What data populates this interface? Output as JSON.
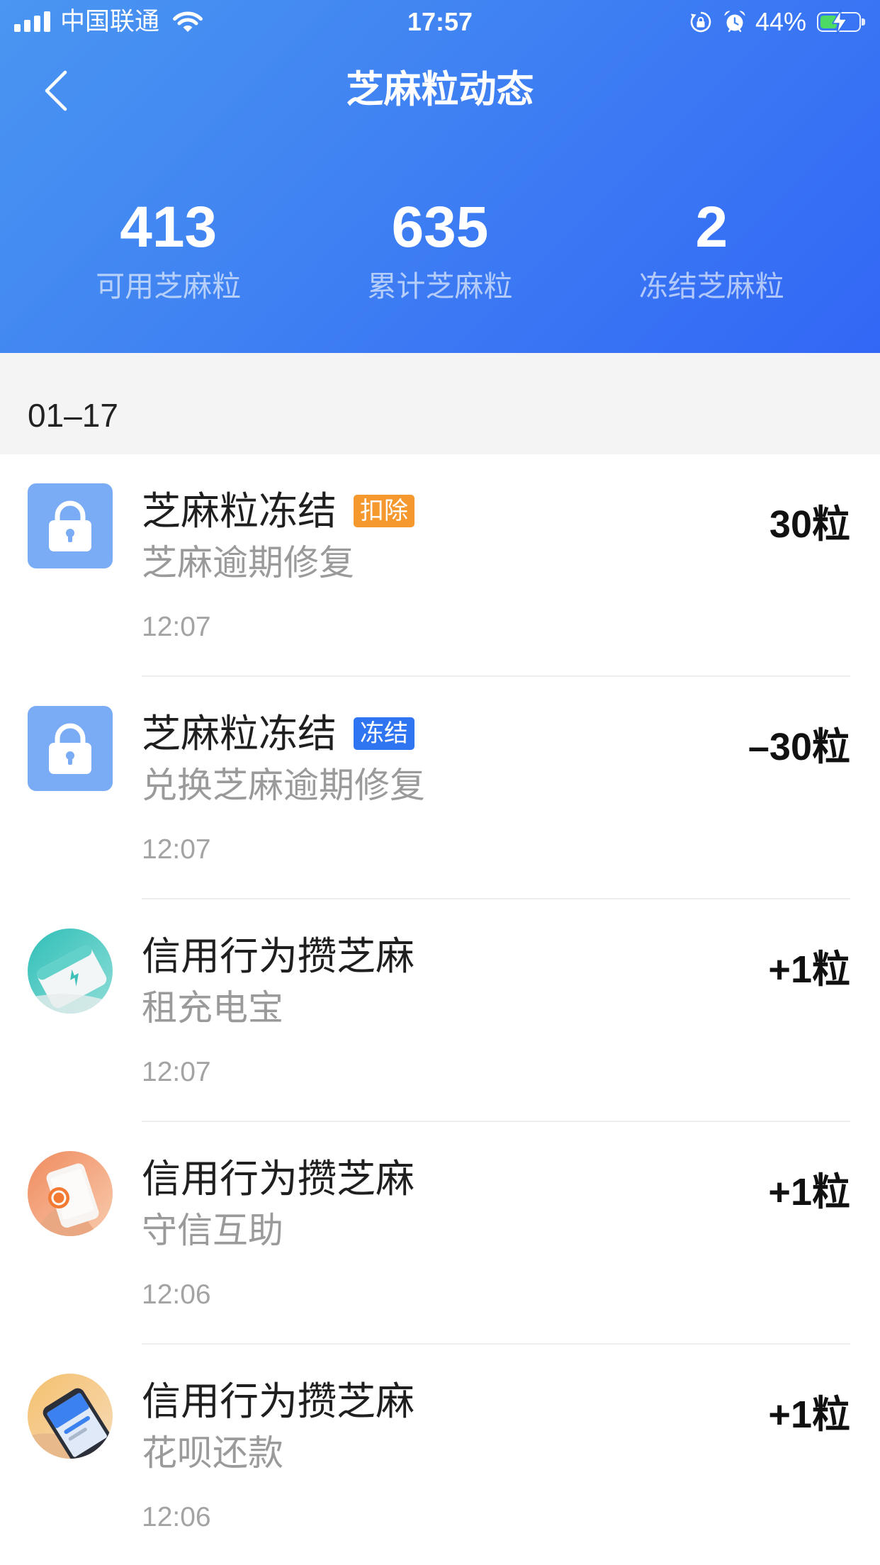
{
  "status_bar": {
    "carrier": "中国联通",
    "time": "17:57",
    "battery_percent": "44%",
    "battery_level": 0.44,
    "charging": true,
    "icons": {
      "signal": "signal-icon",
      "wifi": "wifi-icon",
      "rotation_lock": "rotation-lock-icon",
      "alarm": "alarm-icon",
      "battery": "battery-charging-icon"
    }
  },
  "nav": {
    "back_icon": "chevron-left-icon",
    "title": "芝麻粒动态"
  },
  "stats": [
    {
      "value": "413",
      "label": "可用芝麻粒"
    },
    {
      "value": "635",
      "label": "累计芝麻粒"
    },
    {
      "value": "2",
      "label": "冻结芝麻粒"
    }
  ],
  "date_header": "01–17",
  "records": [
    {
      "icon": "lock-icon",
      "title": "芝麻粒冻结",
      "tag": "扣除",
      "tag_color": "#f5992f",
      "subtitle": "芝麻逾期修复",
      "time": "12:07",
      "amount": "30粒"
    },
    {
      "icon": "lock-icon",
      "title": "芝麻粒冻结",
      "tag": "冻结",
      "tag_color": "#2f74f1",
      "subtitle": "兑换芝麻逾期修复",
      "time": "12:07",
      "amount": "–30粒"
    },
    {
      "icon": "power-bank-icon",
      "title": "信用行为攒芝麻",
      "subtitle": "租充电宝",
      "time": "12:07",
      "amount": "+1粒"
    },
    {
      "icon": "mutual-aid-icon",
      "title": "信用行为攒芝麻",
      "subtitle": "守信互助",
      "time": "12:06",
      "amount": "+1粒"
    },
    {
      "icon": "huabei-repay-icon",
      "title": "信用行为攒芝麻",
      "subtitle": "花呗还款",
      "time": "12:06",
      "amount": "+1粒"
    }
  ],
  "colors": {
    "header_gradient_start": "#4a96f1",
    "header_gradient_end": "#3267f5",
    "date_section_bg": "#f4f4f4",
    "lock_tile": "#7aacf6",
    "battery_fill": "#4cd964"
  }
}
